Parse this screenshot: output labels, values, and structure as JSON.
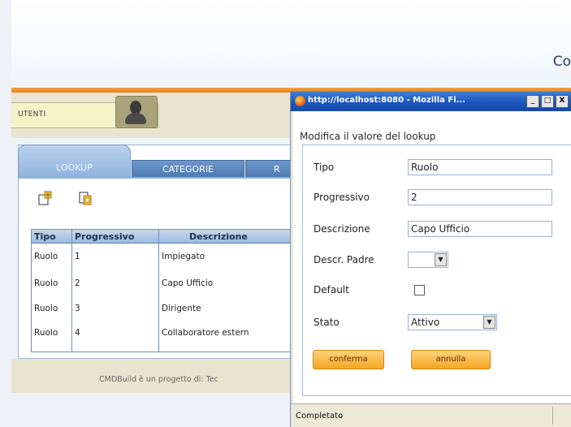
{
  "header": {
    "title": "Co"
  },
  "user_area": {
    "label": "UTENTI"
  },
  "tabs": [
    {
      "label": "LOOKUP",
      "active": true
    },
    {
      "label": "CATEGORIE",
      "active": false
    },
    {
      "label": "R",
      "active": false
    }
  ],
  "toolbar": {
    "icons": [
      "add-lookup-icon",
      "modify-lookup-icon"
    ]
  },
  "grid": {
    "columns": [
      "Tipo",
      "Progressivo",
      "Descrizione"
    ],
    "rows": [
      [
        "Ruolo",
        "1",
        "Impiegato"
      ],
      [
        "Ruolo",
        "2",
        "Capo Ufficio"
      ],
      [
        "Ruolo",
        "3",
        "Dirigente"
      ],
      [
        "Ruolo",
        "4",
        "Collaboratore estern"
      ]
    ]
  },
  "footer": {
    "text": "CMDBuild è un progetto di: Tec"
  },
  "popup": {
    "title": "http://localhost:8080 - Mozilla Fi...",
    "window_buttons": [
      "_",
      "□",
      "X"
    ],
    "form_title": "Modifica il valore del lookup",
    "fields": {
      "tipo": {
        "label": "Tipo",
        "value": "Ruolo"
      },
      "progressivo": {
        "label": "Progressivo",
        "value": "2"
      },
      "descrizione": {
        "label": "Descrizione",
        "value": "Capo Ufficio"
      },
      "descr_padre": {
        "label": "Descr. Padre",
        "value": ""
      },
      "default": {
        "label": "Default",
        "checked": false
      },
      "stato": {
        "label": "Stato",
        "value": "Attivo"
      }
    },
    "buttons": {
      "confirm": "conferma",
      "cancel": "annulla"
    },
    "status": "Completato"
  },
  "colors": {
    "accent_orange": "#f08c24",
    "tab_blue": "#4a78b2",
    "titlebar_blue": "#1c55c0"
  }
}
